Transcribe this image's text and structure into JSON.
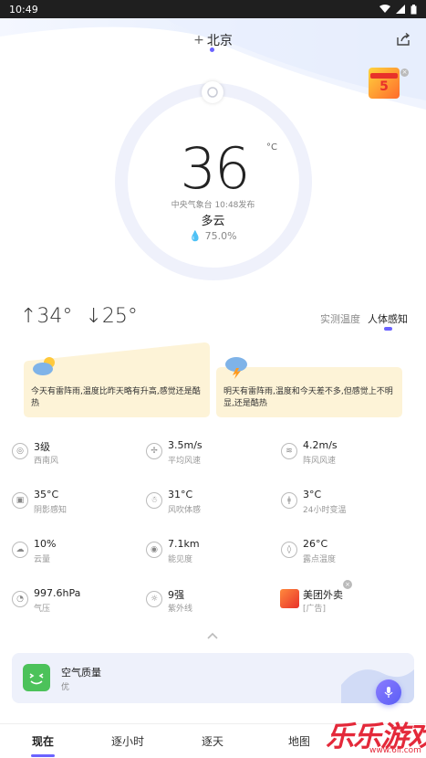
{
  "status_bar": {
    "time": "10:49"
  },
  "header": {
    "add_symbol": "+",
    "city": "北京"
  },
  "current": {
    "temperature": "36",
    "unit": "°C",
    "publish": "中央气象台 10:48发布",
    "condition": "多云",
    "humidity": "75.0%"
  },
  "ad_top": {
    "number": "5"
  },
  "range": {
    "high": "↑34°",
    "low": "↓25°"
  },
  "temp_tabs": {
    "measured": "实测温度",
    "feel": "人体感知"
  },
  "tips": {
    "today": "今天有雷阵雨,温度比昨天略有升高,感觉还是酷热",
    "tomorrow": "明天有雷阵雨,温度和今天差不多,但感觉上不明显,还是酷热"
  },
  "metrics": [
    {
      "icon": "compass-icon",
      "value": "3级",
      "label": "西南风"
    },
    {
      "icon": "wind-turbine-icon",
      "value": "3.5m/s",
      "label": "平均风速"
    },
    {
      "icon": "gust-icon",
      "value": "4.2m/s",
      "label": "阵风风速"
    },
    {
      "icon": "shade-icon",
      "value": "35°C",
      "label": "阴影感知"
    },
    {
      "icon": "wind-chill-icon",
      "value": "31°C",
      "label": "风吹体感"
    },
    {
      "icon": "thermometer-icon",
      "value": "3°C",
      "label": "24小时变温"
    },
    {
      "icon": "cloud-icon",
      "value": "10%",
      "label": "云量"
    },
    {
      "icon": "eye-icon",
      "value": "7.1km",
      "label": "能见度"
    },
    {
      "icon": "dew-icon",
      "value": "26°C",
      "label": "露点温度"
    },
    {
      "icon": "gauge-icon",
      "value": "997.6hPa",
      "label": "气压"
    },
    {
      "icon": "sun-uv-icon",
      "value": "9强",
      "label": "紫外线"
    },
    {
      "icon": "ad-icon",
      "value": "美团外卖",
      "label": "[广告]"
    }
  ],
  "air_quality": {
    "title": "空气质量",
    "level": "优"
  },
  "nav": {
    "now": "现在",
    "hourly": "逐小时",
    "daily": "逐天",
    "map": "地图"
  },
  "watermark": {
    "text": "乐乐游戏",
    "url": "www.6ll.com"
  },
  "colors": {
    "accent": "#6b63ff",
    "tip_bg": "#fdf3d7",
    "aq_green": "#4cc25a"
  }
}
